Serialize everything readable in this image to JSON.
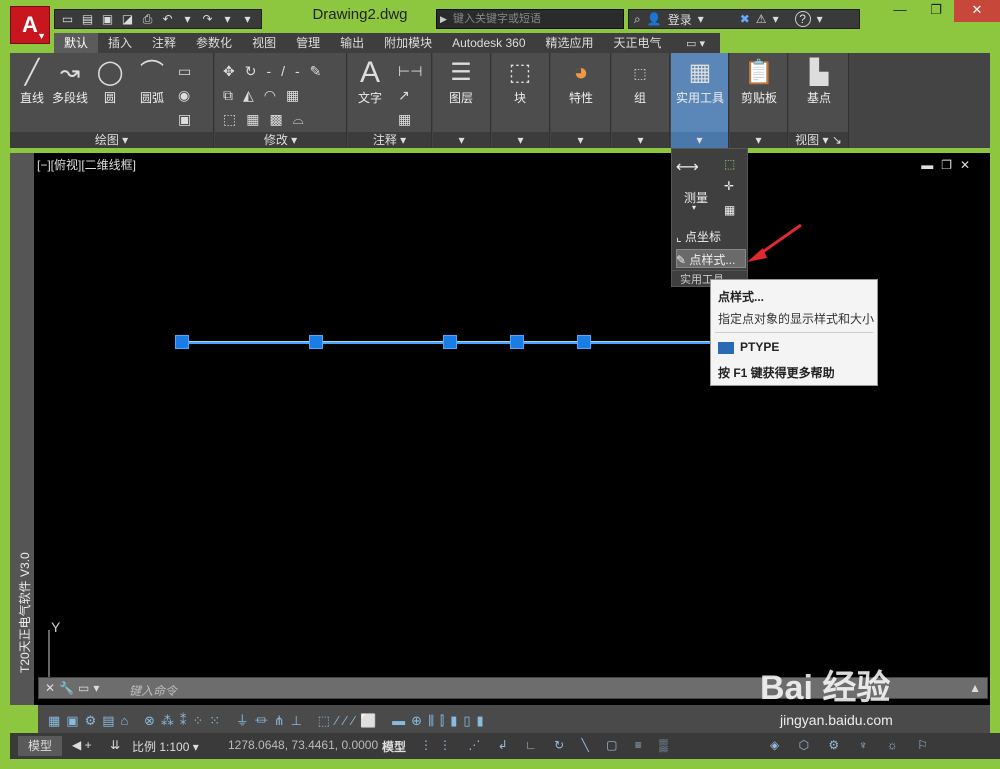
{
  "app": {
    "logo": "A",
    "document_title": "Drawing2.dwg",
    "search_placeholder": "键入关键字或短语",
    "login_label": "登录",
    "help_label": "?"
  },
  "window_controls": {
    "minimize": "—",
    "maximize": "❐",
    "close": "✕"
  },
  "ribbon_tabs": [
    "默认",
    "插入",
    "注释",
    "参数化",
    "视图",
    "管理",
    "输出",
    "附加模块",
    "Autodesk 360",
    "精选应用",
    "天正电气"
  ],
  "ribbon": {
    "draw": {
      "title": "绘图",
      "tools": [
        "直线",
        "多段线",
        "圆",
        "圆弧"
      ]
    },
    "modify": {
      "title": "修改"
    },
    "annotation": {
      "title": "注释",
      "tools": [
        "文字"
      ]
    },
    "layers": "图层",
    "block": "块",
    "properties": "特性",
    "group": "组",
    "utilities": "实用工具",
    "clipboard": "剪贴板",
    "view": {
      "title": "视图",
      "base": "基点"
    }
  },
  "viewport_label": "[−][俯视][二维线框]",
  "side_label": "T20天正电气软件 V3.0",
  "dropdown": {
    "measure": "测量",
    "point_coords": "点坐标",
    "point_style": "点样式...",
    "footer": "实用工具"
  },
  "tooltip": {
    "title": "点样式...",
    "description": "指定点对象的显示样式和大小",
    "command": "PTYPE",
    "help": "按 F1 键获得更多帮助"
  },
  "ucs_label": "Y",
  "command_line": {
    "placeholder": "键入命令"
  },
  "status_bar": {
    "model_tab": "模型",
    "scale": "比例 1:100",
    "coordinates": "1278.0648, 73.4461, 0.0000",
    "model_button": "模型"
  },
  "watermark": {
    "brand": "Bai 经验",
    "url": "jingyan.baidu.com"
  }
}
